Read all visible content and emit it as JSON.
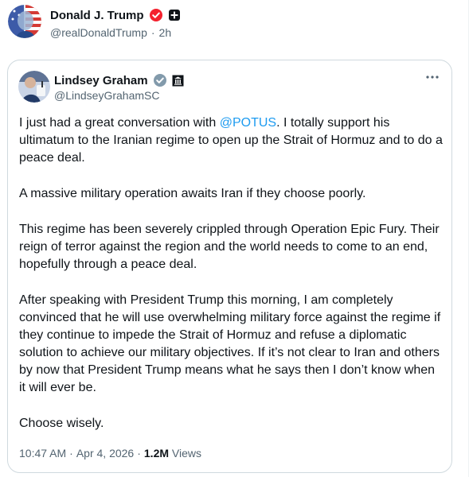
{
  "post": {
    "author_name": "Donald J. Trump",
    "author_handle": "@realDonaldTrump",
    "time_ago": "2h",
    "separator": "·",
    "icons": [
      "patriotic-portrait-avatar",
      "red-verified-badge-icon",
      "plus-square-icon"
    ],
    "colors": {
      "verified_badge": "#f4212e",
      "muted_text": "#536471",
      "link": "#1d9bf0",
      "border": "#cfd9de"
    }
  },
  "quoted_post": {
    "author_name": "Lindsey Graham",
    "author_handle": "@LindseyGrahamSC",
    "icons": [
      "government-verified-badge-icon",
      "institution-badge-icon",
      "more-options-icon"
    ],
    "body": {
      "paragraph_1_before": "I just had a great conversation with ",
      "mention": "@POTUS",
      "paragraph_1_after": ". I totally support his ultimatum to the Iranian regime to open up the Strait of Hormuz and to do a peace deal.",
      "paragraph_2": "A massive military operation awaits Iran if they choose poorly.",
      "paragraph_3": "This regime has been severely crippled through Operation Epic Fury. Their reign of terror against the region and the world needs to come to an end, hopefully through a peace deal.",
      "paragraph_4": "After speaking with President Trump this morning, I am completely convinced that he will use overwhelming military force against the regime if they continue to impede the Strait of Hormuz and refuse a diplomatic solution to achieve our military objectives. If it’s not clear to Iran and others by now that President Trump means what he says then I don’t know when it will ever be.",
      "paragraph_5": "Choose wisely."
    },
    "meta": {
      "time": "10:47 AM",
      "date": "Apr 4, 2026",
      "separator": "·",
      "views_count": "1.2M",
      "views_label": "Views"
    }
  }
}
